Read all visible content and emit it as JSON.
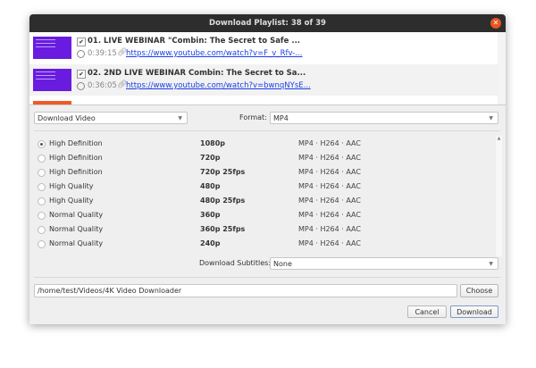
{
  "window": {
    "title": "Download Playlist: 38 of 39"
  },
  "playlist": [
    {
      "title": "01. LIVE WEBINAR \"Combin: The Secret to Safe ...",
      "checked": true,
      "duration": "0:39:15",
      "url": "https://www.youtube.com/watch?v=F_v_Rfv-..."
    },
    {
      "title": "02. 2ND LIVE WEBINAR Combin: The Secret to Sa...",
      "checked": true,
      "duration": "0:36:05",
      "url": "https://www.youtube.com/watch?v=bwnqNYsE..."
    }
  ],
  "controls": {
    "mode": "Download Video",
    "format_label": "Format:",
    "format": "MP4",
    "subtitles_label": "Download Subtitles:",
    "subtitles": "None",
    "path": "/home/test/Videos/4K Video Downloader",
    "choose": "Choose",
    "cancel": "Cancel",
    "download": "Download"
  },
  "qualities": [
    {
      "name": "High Definition",
      "res": "1080p",
      "fmt": "MP4 · H264 · AAC",
      "selected": true
    },
    {
      "name": "High Definition",
      "res": "720p",
      "fmt": "MP4 · H264 · AAC"
    },
    {
      "name": "High Definition",
      "res": "720p 25fps",
      "fmt": "MP4 · H264 · AAC"
    },
    {
      "name": "High Quality",
      "res": "480p",
      "fmt": "MP4 · H264 · AAC"
    },
    {
      "name": "High Quality",
      "res": "480p 25fps",
      "fmt": "MP4 · H264 · AAC"
    },
    {
      "name": "Normal Quality",
      "res": "360p",
      "fmt": "MP4 · H264 · AAC"
    },
    {
      "name": "Normal Quality",
      "res": "360p 25fps",
      "fmt": "MP4 · H264 · AAC"
    },
    {
      "name": "Normal Quality",
      "res": "240p",
      "fmt": "MP4 · H264 · AAC"
    }
  ],
  "colors": {
    "titlebar": "#2d2d2d",
    "close": "#e95420",
    "link": "#1a3ee8",
    "thumbnail": "#6a1be0"
  }
}
